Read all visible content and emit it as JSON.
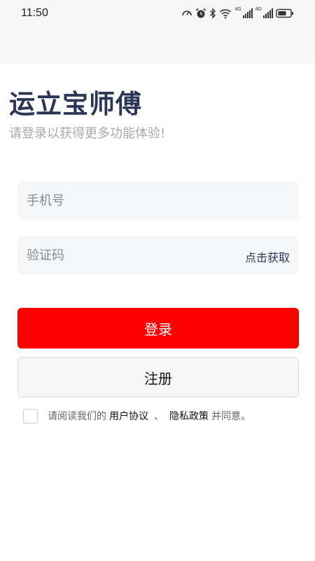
{
  "status_bar": {
    "time": "11:50",
    "net1": "4G",
    "net2": "4G",
    "icons": [
      "speedometer-icon",
      "alarm-icon",
      "bluetooth-icon",
      "wifi-icon",
      "signal-icon",
      "signal-icon",
      "battery-icon"
    ]
  },
  "header": {
    "title": "运立宝师傅",
    "subtitle": "请登录以获得更多功能体验!"
  },
  "form": {
    "phone_placeholder": "手机号",
    "code_placeholder": "验证码",
    "get_code": "点击获取"
  },
  "buttons": {
    "login": "登录",
    "register": "注册"
  },
  "agreement": {
    "prefix": "请阅读我们的",
    "user_agreement": "用户协议",
    "separator": "、",
    "privacy_policy": "隐私政策",
    "suffix": "并同意。"
  },
  "colors": {
    "primary_red": "#ff0000",
    "title_navy": "#2b3556"
  }
}
